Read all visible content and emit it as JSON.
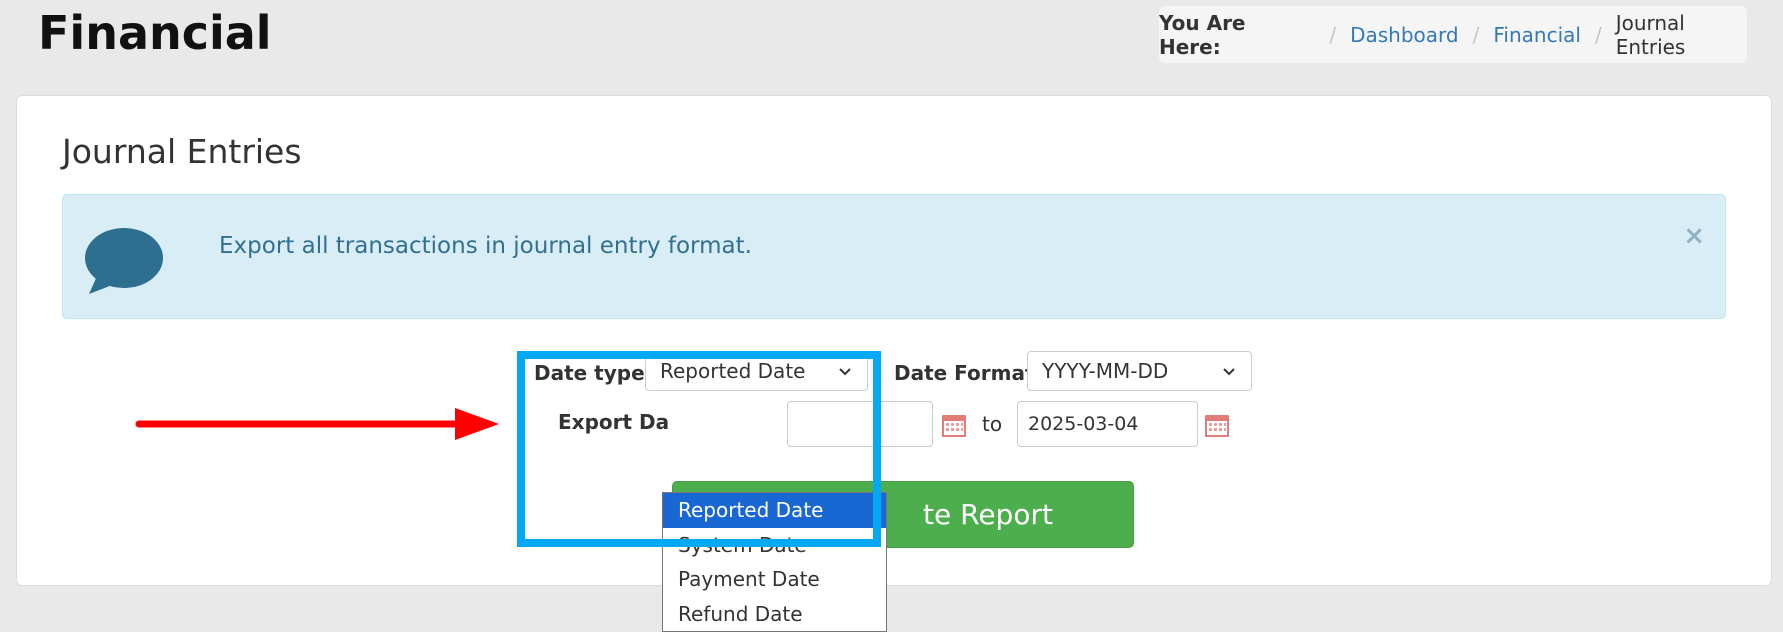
{
  "header": {
    "title": "Financial"
  },
  "breadcrumb": {
    "label": "You Are Here:",
    "items": [
      "Dashboard",
      "Financial"
    ],
    "current": "Journal Entries",
    "separator": "/"
  },
  "panel": {
    "title": "Journal Entries"
  },
  "alert": {
    "message": "Export all transactions in journal entry format.",
    "close": "×",
    "icon": "speech-bubble-icon"
  },
  "form": {
    "date_type_label": "Date type:",
    "date_type_value": "Reported Date",
    "date_type_options": [
      "Reported Date",
      "System Date",
      "Payment Date",
      "Refund Date"
    ],
    "date_format_label": "Date Format:",
    "date_format_value": "YYYY-MM-DD",
    "export_date_label": "Export Da",
    "to_label": "to",
    "end_date_value": "2025-03-04",
    "generate_button": "te Report"
  },
  "colors": {
    "highlight": "#03a9f4",
    "arrow": "#ff0000",
    "button": "#4cae4c",
    "alert_bg": "#d9edf7",
    "selected_option": "#1967d2"
  }
}
